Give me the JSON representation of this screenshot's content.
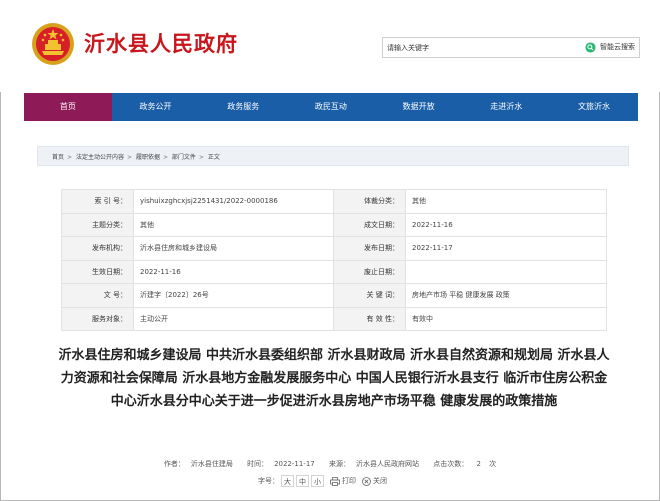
{
  "header": {
    "site_title": "沂水县人民政府",
    "emblem_icon": "national-emblem-icon",
    "search_placeholder": "请输入关键字",
    "ai_search_label": "智能云搜索"
  },
  "nav": {
    "items": [
      {
        "label": "首页",
        "active": true
      },
      {
        "label": "政务公开",
        "active": false
      },
      {
        "label": "政务服务",
        "active": false
      },
      {
        "label": "政民互动",
        "active": false
      },
      {
        "label": "数据开放",
        "active": false
      },
      {
        "label": "走进沂水",
        "active": false
      },
      {
        "label": "文旅沂水",
        "active": false
      }
    ]
  },
  "breadcrumb": [
    "首页",
    "法定主动公开内容",
    "履职依据",
    "部门文件",
    "正文"
  ],
  "info": {
    "index_label": "索 引 号：",
    "index_value": "yishuixzghcxjsj2251431/2022-0000186",
    "carrier_label": "体裁分类：",
    "carrier_value": "其他",
    "topic_label": "主题分类：",
    "topic_value": "其他",
    "written_label": "成文日期：",
    "written_value": "2022-11-16",
    "org_label": "发布机构：",
    "org_value": "沂水县住房和城乡建设局",
    "published_label": "发布日期：",
    "published_value": "2022-11-17",
    "effective_label": "生效日期：",
    "effective_value": "2022-11-16",
    "abolish_label": "废止日期：",
    "abolish_value": "",
    "docno_label": "文 号：",
    "docno_value": "沂建字〔2022〕26号",
    "keywords_label": "关 键 词：",
    "keywords_value": "房地产市场 平稳 健康发展 政策",
    "target_label": "服务对象：",
    "target_value": "主动公开",
    "validity_label": "有 效 性：",
    "validity_value": "有效中"
  },
  "article": {
    "title": "沂水县住房和城乡建设局 中共沂水县委组织部 沂水县财政局 沂水县自然资源和规划局 沂水县人力资源和社会保障局 沂水县地方金融发展服务中心 中国人民银行沂水县支行 临沂市住房公积金中心沂水县分中心关于进一步促进沂水县房地产市场平稳 健康发展的政策措施",
    "author_label": "作者：",
    "author": "沂水县住建局",
    "time_label": "时间：",
    "time": "2022-11-17",
    "source_label": "来源：",
    "source": "沂水县人民政府网站",
    "views_label": "点击次数：",
    "views": "2",
    "views_unit": "次"
  },
  "tools": {
    "font_size_label": "字号：",
    "sizes": [
      "大",
      "中",
      "小"
    ],
    "print_label": "打印",
    "close_label": "关闭"
  },
  "colors": {
    "brand_red": "#c8161d",
    "nav_blue": "#1a5ea8",
    "nav_active": "#8e1a57"
  }
}
